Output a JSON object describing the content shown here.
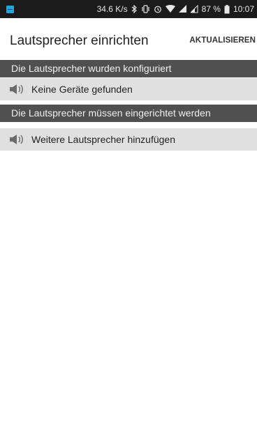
{
  "status_bar": {
    "network_speed": "34.6 K/s",
    "battery": "87 %",
    "time": "10:07"
  },
  "app_bar": {
    "title": "Lautsprecher einrichten",
    "refresh_label": "AKTUALISIEREN"
  },
  "sections": {
    "configured_header": "Die Lautsprecher wurden konfiguriert",
    "no_devices_label": "Keine Geräte gefunden",
    "setup_header": "Die Lautsprecher müssen eingerichtet werden",
    "add_speakers_label": "Weitere Lautsprecher hinzufügen"
  },
  "icons": {
    "list_item_icon": "speaker-icon"
  },
  "colors": {
    "status_bar_bg": "#1b1b1b",
    "section_header_bg": "#505050",
    "list_item_bg": "#e0e0e0",
    "app_icon": "#1ea7e1"
  }
}
